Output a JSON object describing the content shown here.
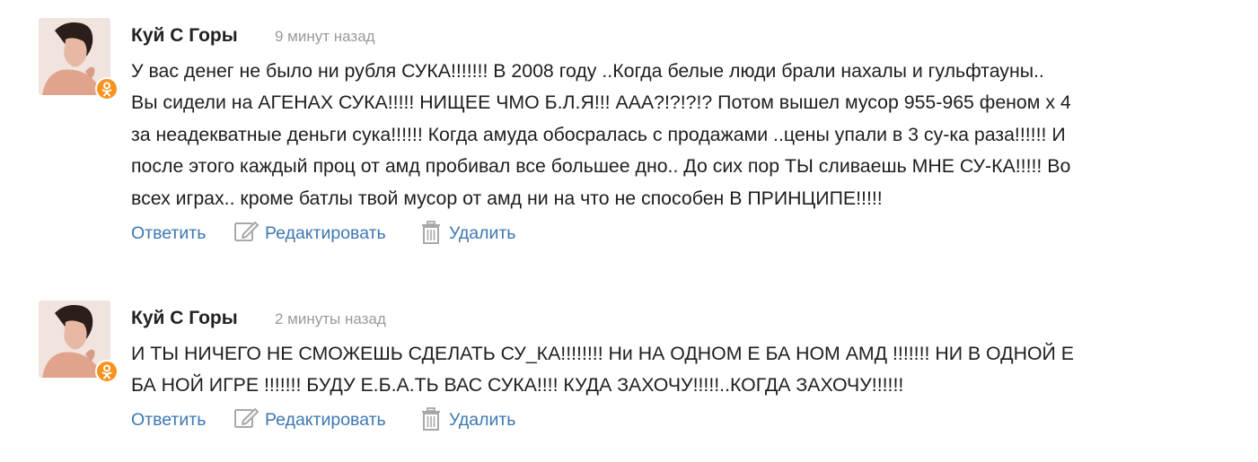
{
  "comments": [
    {
      "author": "Куй С Горы",
      "time": "9 минут назад",
      "text_lines": [
        "У вас денег не было ни рубля СУКА!!!!!!! В 2008 году ..Когда белые люди брали нахалы и гульфтауны..",
        "Вы сидели на АГЕНАХ СУКА!!!!! НИЩЕЕ ЧМО Б.Л.Я!!! ААА?!?!?!? Потом вышел мусор  955-965 феном х 4",
        "за неадекватные деньги сука!!!!!! Когда амуда обосралась с продажами ..цены упали в  3 су-ка раза!!!!!! И",
        "после этого каждый проц от амд пробивал все большее дно.. До сих пор ТЫ сливаешь МНЕ СУ-КА!!!!! Во",
        "всех играх.. кроме батлы твой мусор от амд ни на что не способен В ПРИНЦИПЕ!!!!!"
      ],
      "actions": {
        "reply": "Ответить",
        "edit": "Редактировать",
        "delete": "Удалить"
      }
    },
    {
      "author": "Куй С Горы",
      "time": "2 минуты назад",
      "text_lines": [
        "И ТЫ НИЧЕГО НЕ СМОЖЕШЬ СДЕЛАТЬ СУ_КА!!!!!!!! Ни НА ОДНОМ Е БА НОМ АМД !!!!!!! НИ В ОДНОЙ Е",
        "БА НОЙ ИГРЕ !!!!!!! БУДУ Е.Б.А.ТЬ ВАС СУКА!!!! КУДА ЗАХОЧУ!!!!!..КОГДА ЗАХОЧУ!!!!!!"
      ],
      "actions": {
        "reply": "Ответить",
        "edit": "Редактировать",
        "delete": "Удалить"
      }
    }
  ],
  "icons": {
    "avatar_badge": "odnoklassniki-icon",
    "edit": "pencil-edit-icon",
    "delete": "trash-icon"
  },
  "colors": {
    "link": "#3d78b3",
    "author": "#222222",
    "time": "#9a9a9a",
    "badge": "#f7931e",
    "icon": "#a8a8a8"
  }
}
